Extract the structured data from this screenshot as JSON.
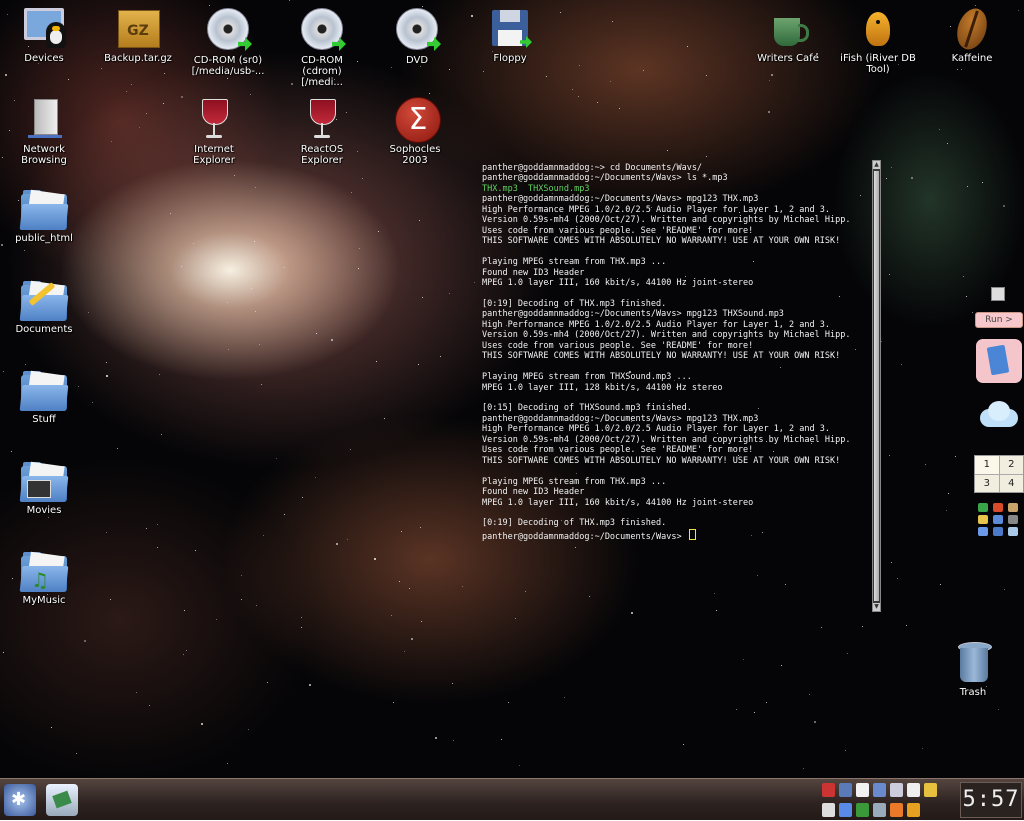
{
  "desktop_icons": {
    "devices": "Devices",
    "backup": "Backup.tar.gz",
    "cdrom_sr0": "CD-ROM (sr0)\n[/media/usb-...",
    "cdrom": "CD-ROM\n(cdrom) [/medi...",
    "dvd": "DVD",
    "floppy": "Floppy",
    "writers_cafe": "Writers Cafe",
    "ifish": "iFish (iRiver DB\nTool)",
    "kaffeine": "Kaffeine",
    "network": "Network\nBrowsing",
    "ie": "Internet\nExplorer",
    "reactos": "ReactOS\nExplorer",
    "sophocles": "Sophocles\n2003",
    "public_html": "public_html",
    "documents": "Documents",
    "stuff": "Stuff",
    "movies": "Movies",
    "mymusic": "MyMusic",
    "trash": "Trash"
  },
  "terminal": {
    "lines": [
      "panther@goddamnmaddog:~> cd Documents/Wavs/",
      "panther@goddamnmaddog:~/Documents/Wavs> ls *.mp3",
      "THX.mp3  THXSound.mp3",
      "panther@goddamnmaddog:~/Documents/Wavs> mpg123 THX.mp3",
      "High Performance MPEG 1.0/2.0/2.5 Audio Player for Layer 1, 2 and 3.",
      "Version 0.59s-mh4 (2000/Oct/27). Written and copyrights by Michael Hipp.",
      "Uses code from various people. See 'README' for more!",
      "THIS SOFTWARE COMES WITH ABSOLUTELY NO WARRANTY! USE AT YOUR OWN RISK!",
      "",
      "Playing MPEG stream from THX.mp3 ...",
      "Found new ID3 Header",
      "MPEG 1.0 layer III, 160 kbit/s, 44100 Hz joint-stereo",
      "",
      "[0:19] Decoding of THX.mp3 finished.",
      "panther@goddamnmaddog:~/Documents/Wavs> mpg123 THXSound.mp3",
      "High Performance MPEG 1.0/2.0/2.5 Audio Player for Layer 1, 2 and 3.",
      "Version 0.59s-mh4 (2000/Oct/27). Written and copyrights by Michael Hipp.",
      "Uses code from various people. See 'README' for more!",
      "THIS SOFTWARE COMES WITH ABSOLUTELY NO WARRANTY! USE AT YOUR OWN RISK!",
      "",
      "Playing MPEG stream from THXSound.mp3 ...",
      "MPEG 1.0 layer III, 128 kbit/s, 44100 Hz stereo",
      "",
      "[0:15] Decoding of THXSound.mp3 finished.",
      "panther@goddamnmaddog:~/Documents/Wavs> mpg123 THX.mp3",
      "High Performance MPEG 1.0/2.0/2.5 Audio Player for Layer 1, 2 and 3.",
      "Version 0.59s-mh4 (2000/Oct/27). Written and copyrights by Michael Hipp.",
      "Uses code from various people. See 'README' for more!",
      "THIS SOFTWARE COMES WITH ABSOLUTELY NO WARRANTY! USE AT YOUR OWN RISK!",
      "",
      "Playing MPEG stream from THX.mp3 ...",
      "Found new ID3 Header",
      "MPEG 1.0 layer III, 160 kbit/s, 44100 Hz joint-stereo",
      "",
      "[0:19] Decoding of THX.mp3 finished.",
      "panther@goddamnmaddog:~/Documents/Wavs> "
    ],
    "green_line_index": 2
  },
  "dock": {
    "run_label": "Run >",
    "pager": [
      "1",
      "2",
      "3",
      "4"
    ],
    "active_desktop": "1"
  },
  "taskbar": {
    "clock": "5:57"
  },
  "colors": {
    "terminal_text": "#f2f2f2",
    "terminal_green": "#5fd25f",
    "cursor": "#f4e04a"
  }
}
